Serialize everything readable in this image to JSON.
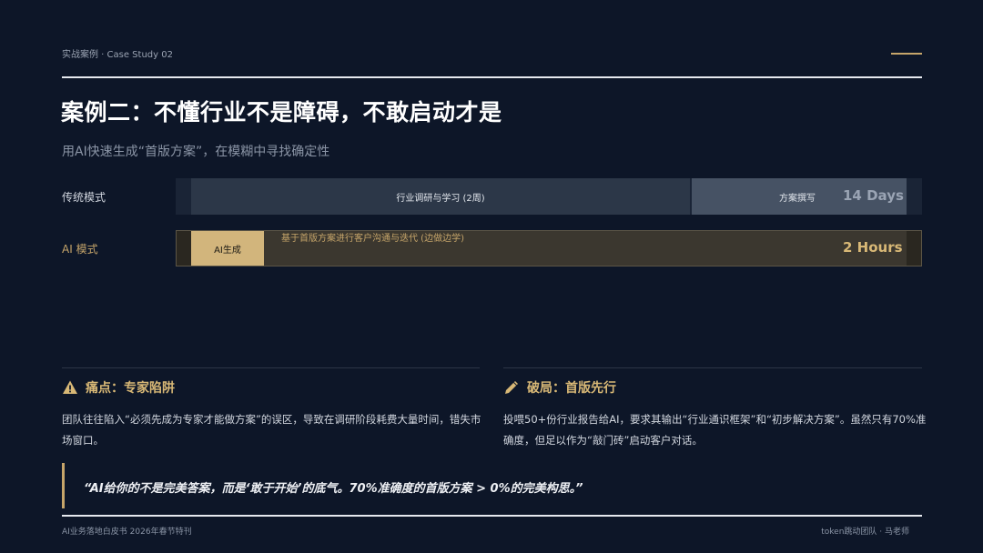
{
  "header": {
    "label": "实战案例 · Case Study 02",
    "accent_color": "#c6a56a"
  },
  "title": "案例二：不懂行业不是障碍，不敢启动才是",
  "subtitle": "用AI快速生成“首版方案”，在模糊中寻找确定性",
  "comparison": {
    "traditional": {
      "label": "传统模式",
      "research_label": "行业调研与学习 (2周)",
      "writing_label": "方案撰写",
      "duration": "14 Days"
    },
    "ai": {
      "label": "AI 模式",
      "generate_label": "AI生成",
      "iterate_label": "基于首版方案进行客户沟通与迭代 (边做边学)",
      "duration": "2 Hours"
    }
  },
  "pain_point": {
    "icon": "warning-icon",
    "heading": "痛点：专家陷阱",
    "body": "团队往往陷入“必须先成为专家才能做方案”的误区，导致在调研阶段耗费大量时间，错失市场窗口。"
  },
  "breakthrough": {
    "icon": "pencil-icon",
    "heading": "破局：首版先行",
    "body": "投喂50+份行业报告给AI，要求其输出“行业通识框架”和“初步解决方案”。虽然只有70%准确度，但足以作为“敲门砖”启动客户对话。"
  },
  "quote": "“AI给你的不是完美答案，而是‘敢于开始’的底气。70%准确度的首版方案 > 0%的完美构思。”",
  "footer": {
    "left": "AI业务落地白皮书 2026年春节特刊",
    "right": "token跳动团队 · 马老师"
  }
}
